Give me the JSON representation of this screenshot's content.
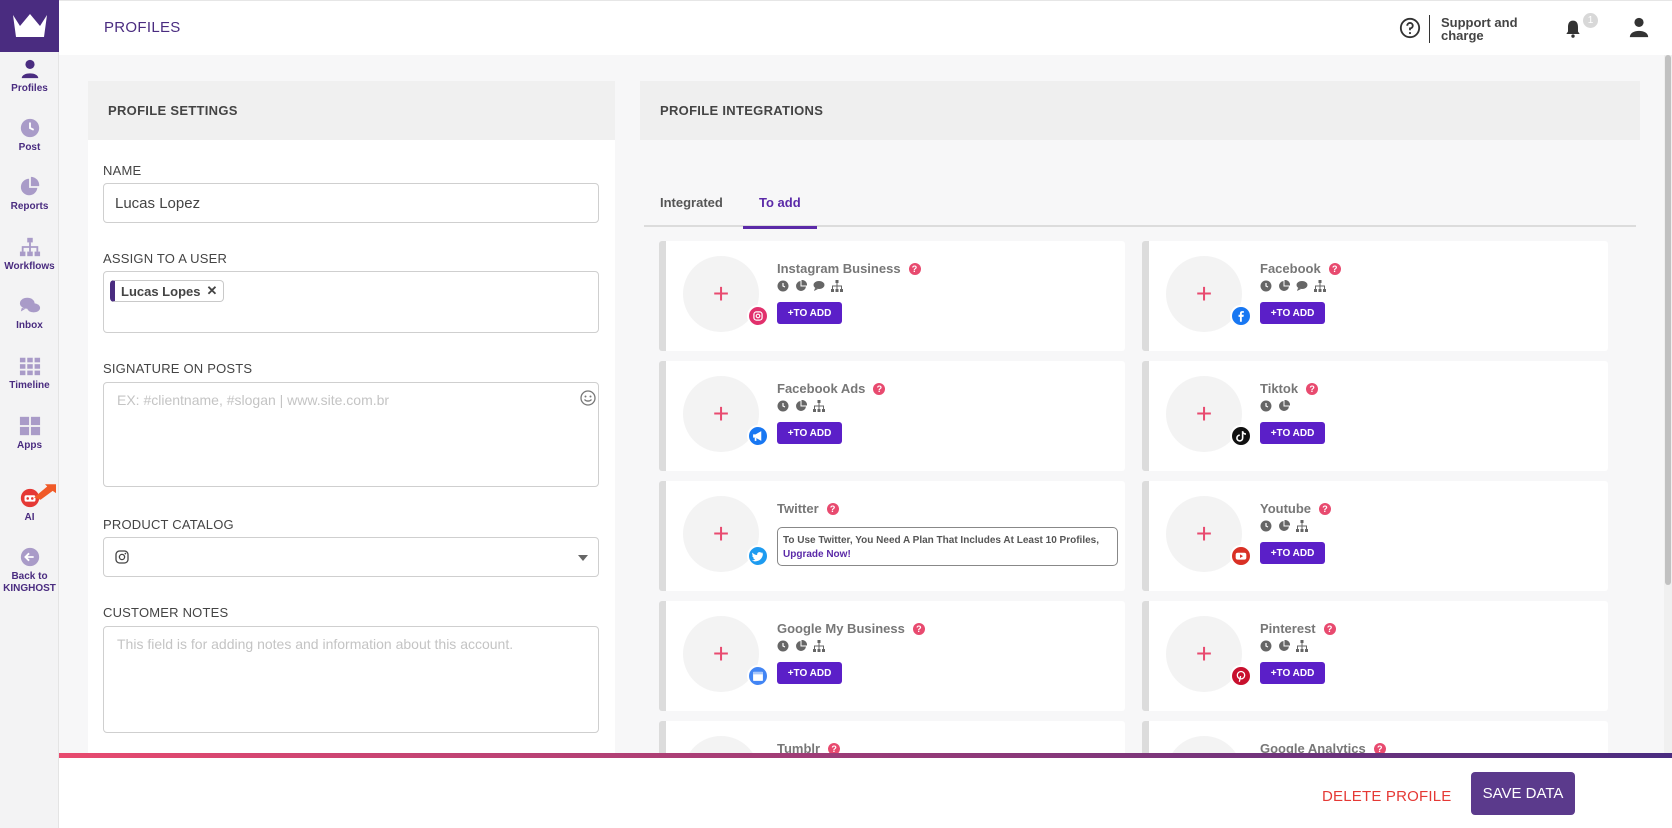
{
  "header": {
    "title": "PROFILES",
    "support_label": "Support and charge",
    "notifications_count": "1"
  },
  "sidebar": {
    "items": [
      {
        "label": "Profiles",
        "icon": "user-icon"
      },
      {
        "label": "Post",
        "icon": "clock-icon"
      },
      {
        "label": "Reports",
        "icon": "pie-chart-icon"
      },
      {
        "label": "Workflows",
        "icon": "sitemap-icon"
      },
      {
        "label": "Inbox",
        "icon": "chat-icon"
      },
      {
        "label": "Timeline",
        "icon": "grid-icon"
      },
      {
        "label": "Apps",
        "icon": "apps-icon"
      },
      {
        "label": "AI",
        "icon": "robot-icon"
      },
      {
        "label": "Back to KINGHOST",
        "icon": "back-arrow-icon"
      }
    ]
  },
  "profile_settings": {
    "title": "PROFILE SETTINGS",
    "name_label": "NAME",
    "name_value": "Lucas Lopez",
    "assign_label": "ASSIGN TO A USER",
    "assigned_user": "Lucas Lopes",
    "signature_label": "SIGNATURE ON POSTS",
    "signature_placeholder": "EX: #clientname, #slogan | www.site.com.br",
    "catalog_label": "PRODUCT CATALOG",
    "notes_label": "CUSTOMER NOTES",
    "notes_placeholder": "This field is for adding notes and information about this account."
  },
  "integrations": {
    "title": "PROFILE INTEGRATIONS",
    "tabs": [
      {
        "label": "Integrated",
        "active": false
      },
      {
        "label": "To add",
        "active": true
      }
    ],
    "add_label": "+TO ADD",
    "tooltip_text": "To Use Twitter, You Need A Plan That Includes At Least 10 Profiles,",
    "tooltip_link": "Upgrade Now!",
    "items": [
      {
        "name": "Instagram Business",
        "badge_color": "#e1306c"
      },
      {
        "name": "Facebook",
        "badge_color": "#1877f2"
      },
      {
        "name": "Facebook Ads",
        "badge_color": "#1877f2"
      },
      {
        "name": "Tiktok",
        "badge_color": "#111111"
      },
      {
        "name": "Twitter",
        "badge_color": "#1d9bf0"
      },
      {
        "name": "Youtube",
        "badge_color": "#d93025"
      },
      {
        "name": "Google My Business",
        "badge_color": "#4285f4"
      },
      {
        "name": "Pinterest",
        "badge_color": "#c8102e"
      },
      {
        "name": "Tumblr",
        "badge_color": "#35465c"
      },
      {
        "name": "Google Analytics",
        "badge_color": "#f57c00"
      }
    ]
  },
  "footer": {
    "delete_label": "DELETE PROFILE",
    "save_label": "SAVE DATA"
  },
  "colors": {
    "brand": "#4a2c80",
    "accent": "#5b1fc8",
    "danger": "#e53935",
    "pink": "#e84a6f"
  }
}
